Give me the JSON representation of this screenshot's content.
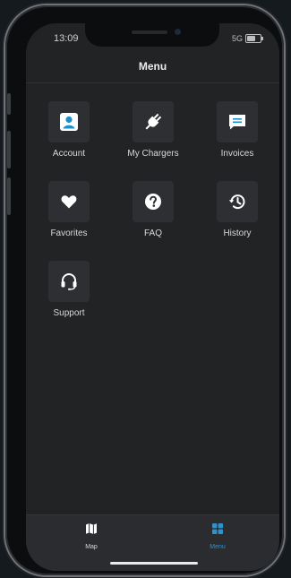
{
  "status_bar": {
    "time": "13:09",
    "signal": "5G",
    "battery_level": 0.7
  },
  "header": {
    "title": "Menu"
  },
  "menu": [
    {
      "label": "Account",
      "icon": "account-icon",
      "accent": true
    },
    {
      "label": "My Chargers",
      "icon": "plug-icon",
      "accent": true
    },
    {
      "label": "Invoices",
      "icon": "invoice-icon",
      "accent": true
    },
    {
      "label": "Favorites",
      "icon": "heart-icon",
      "accent": false
    },
    {
      "label": "FAQ",
      "icon": "question-icon",
      "accent": false
    },
    {
      "label": "History",
      "icon": "history-icon",
      "accent": false
    },
    {
      "label": "Support",
      "icon": "headset-icon",
      "accent": false
    }
  ],
  "tabbar": {
    "tabs": [
      {
        "label": "Map",
        "icon": "map-icon",
        "active": false
      },
      {
        "label": "Menu",
        "icon": "grid-icon",
        "active": true
      }
    ]
  },
  "colors": {
    "accent": "#1f8fcc",
    "screen_bg": "#222325",
    "tabbar_bg": "#2b2c2f",
    "tile_bg": "#2e2f32",
    "active_tab": "#2c93cf",
    "inactive_tab": "#d8d8d8"
  }
}
